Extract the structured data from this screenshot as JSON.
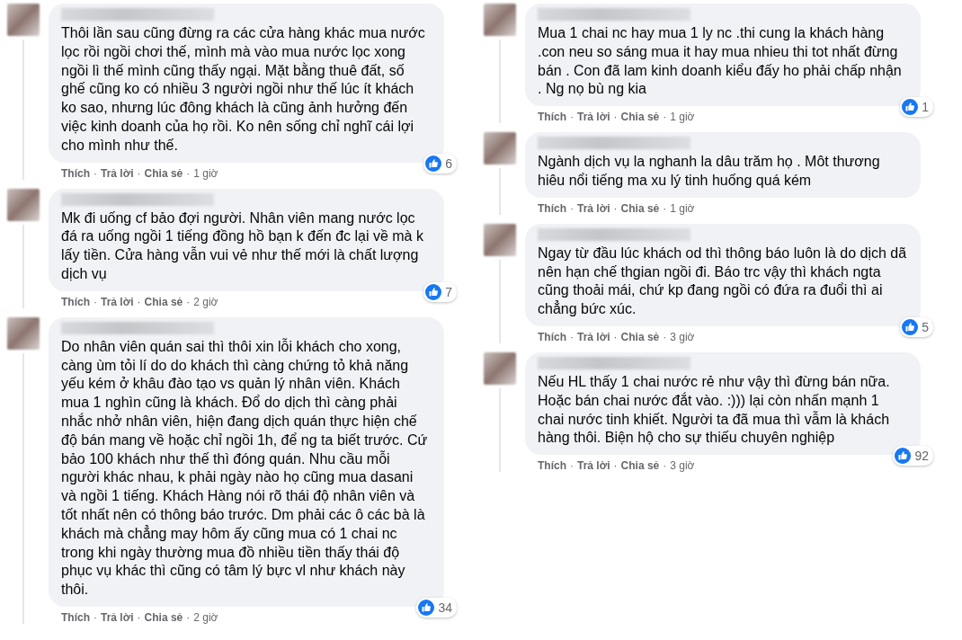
{
  "columns": [
    {
      "comments": [
        {
          "text": "Thôi lần sau cũng đừng ra các cửa hàng khác mua nước lọc rồi ngồi chơi thế, mình mà vào mua nước lọc xong ngồi lì thế mình cũng thấy ngại. Mặt bằng thuê đất, số ghế cũng ko có nhiều 3 người ngồi như thế lúc ít khách ko sao, nhưng lúc đông khách là cũng ảnh hưởng đến việc kinh doanh của họ rồi. Ko nên sống chỉ nghĩ cái lợi cho mình như thế.",
          "likes": "6",
          "actions": [
            {
              "kind": "link",
              "label": "Thích"
            },
            {
              "kind": "sep",
              "label": "·"
            },
            {
              "kind": "link",
              "label": "Trả lời"
            },
            {
              "kind": "sep",
              "label": "·"
            },
            {
              "kind": "link",
              "label": "Chia sẻ"
            },
            {
              "kind": "sep",
              "label": "·"
            },
            {
              "kind": "time",
              "label": "1 giờ"
            }
          ]
        },
        {
          "text": "Mk đi uống cf bảo đợi người. Nhân viên mang nước lọc đá ra uống ngồi 1 tiếng đồng hồ bạn k đến đc lại về mà k lấy tiền. Cửa hàng vẫn vui vẻ như thế mới là chất lượng dịch vụ",
          "likes": "7",
          "actions": [
            {
              "kind": "link",
              "label": "Thích"
            },
            {
              "kind": "sep",
              "label": "·"
            },
            {
              "kind": "link",
              "label": "Trả lời"
            },
            {
              "kind": "sep",
              "label": "·"
            },
            {
              "kind": "link",
              "label": "Chia sẻ"
            },
            {
              "kind": "sep",
              "label": "·"
            },
            {
              "kind": "time",
              "label": "2 giờ"
            }
          ]
        },
        {
          "text": "Do nhân viên quán sai thì thôi xin lỗi khách cho xong, càng ùm tỏi lí do do khách thì càng chứng tỏ khả năng yếu kém ở khâu đào tạo vs quản lý nhân viên. Khách mua 1 nghìn cũng là khách. Đổ do dịch thì càng phải nhắc nhở nhân viên, hiện đang dịch quán thực hiện chế độ bán mang về hoặc chỉ ngồi 1h, để ng ta biết trước. Cứ bảo 100 khách như thế thì đóng quán. Nhu cầu mỗi người khác nhau, k phải ngày nào họ cũng mua dasani và ngồi 1 tiếng. Khách Hàng nói rõ thái độ nhân viên và tốt nhất nên có thông báo trước. Dm phải các ô các bà là khách mà chẳng may hôm ấy cũng mua có 1 chai nc trong khi ngày thường mua đồ nhiều tiền thấy thái độ phục vụ khác thì cũng có tâm lý bực vl như khách này thôi.",
          "likes": "34",
          "actions": [
            {
              "kind": "link",
              "label": "Thích"
            },
            {
              "kind": "sep",
              "label": "·"
            },
            {
              "kind": "link",
              "label": "Trả lời"
            },
            {
              "kind": "sep",
              "label": "·"
            },
            {
              "kind": "link",
              "label": "Chia sẻ"
            },
            {
              "kind": "sep",
              "label": "·"
            },
            {
              "kind": "time",
              "label": "2 giờ"
            }
          ]
        }
      ]
    },
    {
      "comments": [
        {
          "text": "Mua 1 chai nc hay mua 1 ly nc .thi cung la khách hàng .con neu so sáng mua it hay mua nhieu thi tot nhất đừng bán . Con đã lam kinh doanh kiểu đấy ho phải chấp nhận . Ng nọ bù ng kia",
          "likes": "1",
          "actions": [
            {
              "kind": "link",
              "label": "Thích"
            },
            {
              "kind": "sep",
              "label": "·"
            },
            {
              "kind": "link",
              "label": "Trả lời"
            },
            {
              "kind": "sep",
              "label": "·"
            },
            {
              "kind": "link",
              "label": "Chia sẻ"
            },
            {
              "kind": "sep",
              "label": "·"
            },
            {
              "kind": "time",
              "label": "1 giờ"
            }
          ]
        },
        {
          "text": "Ngành dịch vụ la nghanh la dâu trăm họ . Môt thương hiêu nổi tiếng ma xu lý tinh huống quá kém",
          "actions": [
            {
              "kind": "link",
              "label": "Thích"
            },
            {
              "kind": "sep",
              "label": "·"
            },
            {
              "kind": "link",
              "label": "Trả lời"
            },
            {
              "kind": "sep",
              "label": "·"
            },
            {
              "kind": "link",
              "label": "Chia sẻ"
            },
            {
              "kind": "sep",
              "label": "·"
            },
            {
              "kind": "time",
              "label": "1 giờ"
            }
          ]
        },
        {
          "text": "Ngay từ đầu lúc khách od thì thông báo luôn là do dịch dã nên hạn chế thgian ngồi đi. Báo trc vậy thì khách ngta cũng thoải mái, chứ kp đang ngồi có đứa ra đuổi thì ai chẳng bức xúc.",
          "likes": "5",
          "actions": [
            {
              "kind": "link",
              "label": "Thích"
            },
            {
              "kind": "sep",
              "label": "·"
            },
            {
              "kind": "link",
              "label": "Trả lời"
            },
            {
              "kind": "sep",
              "label": "·"
            },
            {
              "kind": "link",
              "label": "Chia sẻ"
            },
            {
              "kind": "sep",
              "label": "·"
            },
            {
              "kind": "time",
              "label": "3 giờ"
            }
          ]
        },
        {
          "text": "Nếu HL thấy 1 chai nước rẻ như vậy thì đừng bán nữa. Hoặc bán chai nước đắt vào. :))) lại còn nhấn mạnh 1 chai nước tinh khiết. Người ta đã mua thì vẫm là khách hàng thôi. Biện hộ cho sự thiếu chuyên nghiệp",
          "likes": "92",
          "actions": [
            {
              "kind": "link",
              "label": "Thích"
            },
            {
              "kind": "sep",
              "label": "·"
            },
            {
              "kind": "link",
              "label": "Trả lời"
            },
            {
              "kind": "sep",
              "label": "·"
            },
            {
              "kind": "link",
              "label": "Chia sẻ"
            },
            {
              "kind": "sep",
              "label": "·"
            },
            {
              "kind": "time",
              "label": "3 giờ"
            }
          ]
        }
      ]
    }
  ]
}
